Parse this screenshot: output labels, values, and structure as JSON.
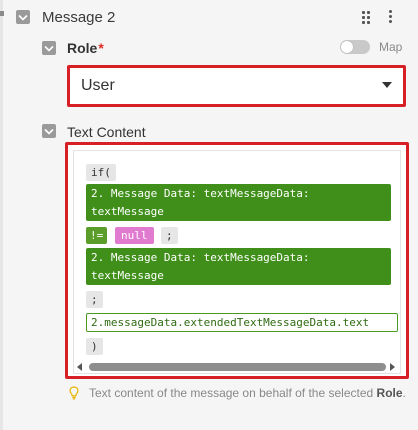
{
  "message": {
    "title": "Message 2"
  },
  "role": {
    "label": "Role",
    "required_mark": "*",
    "map_label": "Map",
    "map_enabled": false,
    "selected_value": "User"
  },
  "text_content": {
    "label": "Text Content",
    "tokens": {
      "if_open": "if(",
      "message_data_1": "2. Message Data: textMessageData:",
      "message_data_1_cont": "textMessage",
      "not_equals": "!=",
      "null": "null",
      "semicolon_1": ";",
      "message_data_2": "2. Message Data: textMessageData:",
      "message_data_2_cont": "textMessage",
      "semicolon_2": ";",
      "extended_path": "2.messageData.extendedTextMessageData.text",
      "close_paren": ")"
    },
    "hint_text": "Text content of the message on behalf of the selected",
    "hint_bold": "Role",
    "hint_end": "."
  },
  "colors": {
    "highlight_border": "#d71f26",
    "token_green": "#3f8f1a",
    "token_pink": "#e07bd0",
    "required": "#d93025"
  }
}
